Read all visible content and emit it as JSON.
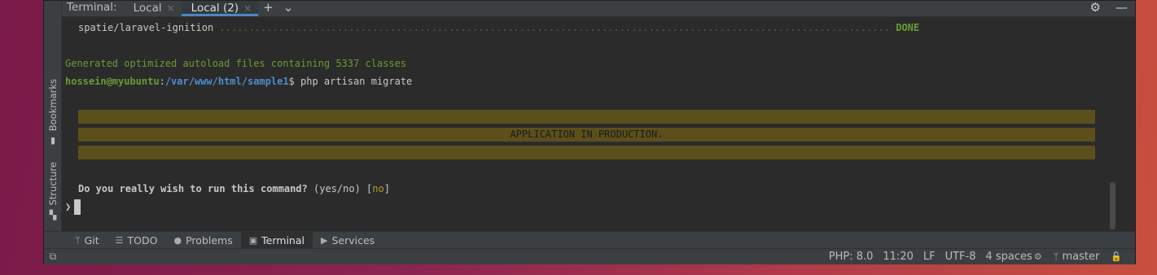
{
  "sidebar": {
    "bookmarks_label": "Bookmarks",
    "structure_label": "Structure"
  },
  "terminal_tabs": {
    "title": "Terminal:",
    "tabs": [
      {
        "label": "Local"
      },
      {
        "label": "Local (2)"
      }
    ],
    "close_glyph": "×",
    "add_glyph": "+",
    "dropdown_glyph": "⌄",
    "settings_glyph": "⚙",
    "minimize_glyph": "—"
  },
  "terminal": {
    "line1_pkg": "spatie/laravel-ignition",
    "line1_dots": " .................................................................................................................. ",
    "line1_status": "DONE",
    "line2": "Generated optimized autoload files containing 5337 classes",
    "prompt_user": "hossein@myubuntu",
    "prompt_colon": ":",
    "prompt_path": "/var/www/html/sample1",
    "prompt_dollar": "$ ",
    "command": "php artisan migrate",
    "banner": "APPLICATION IN PRODUCTION.",
    "question": "Do you really wish to run this command?",
    "options": " (yes/no) ",
    "bracket_open": "[",
    "default": "no",
    "bracket_close": "]",
    "caret": "❯"
  },
  "toolwindows": [
    {
      "label": "Git",
      "icon": "branch-icon",
      "glyph": "ᛘ"
    },
    {
      "label": "TODO",
      "icon": "list-icon",
      "glyph": "☰"
    },
    {
      "label": "Problems",
      "icon": "info-icon",
      "glyph": "●"
    },
    {
      "label": "Terminal",
      "icon": "terminal-icon",
      "glyph": "▣"
    },
    {
      "label": "Services",
      "icon": "play-icon",
      "glyph": "▶"
    }
  ],
  "statusbar": {
    "php": "PHP: 8.0",
    "position": "11:20",
    "line_ending": "LF",
    "encoding": "UTF-8",
    "indent": "4 spaces",
    "branch": "master",
    "layout_glyph": "⧉",
    "indent_glyph": "⚙",
    "branch_glyph": "ᛘ",
    "lock_glyph": "🔓"
  },
  "colors": {
    "background": "#2b2b2b",
    "green": "#6a9a35",
    "path_blue": "#4c8fc8",
    "banner": "#5c4f1c",
    "accent": "#4a88c7"
  }
}
